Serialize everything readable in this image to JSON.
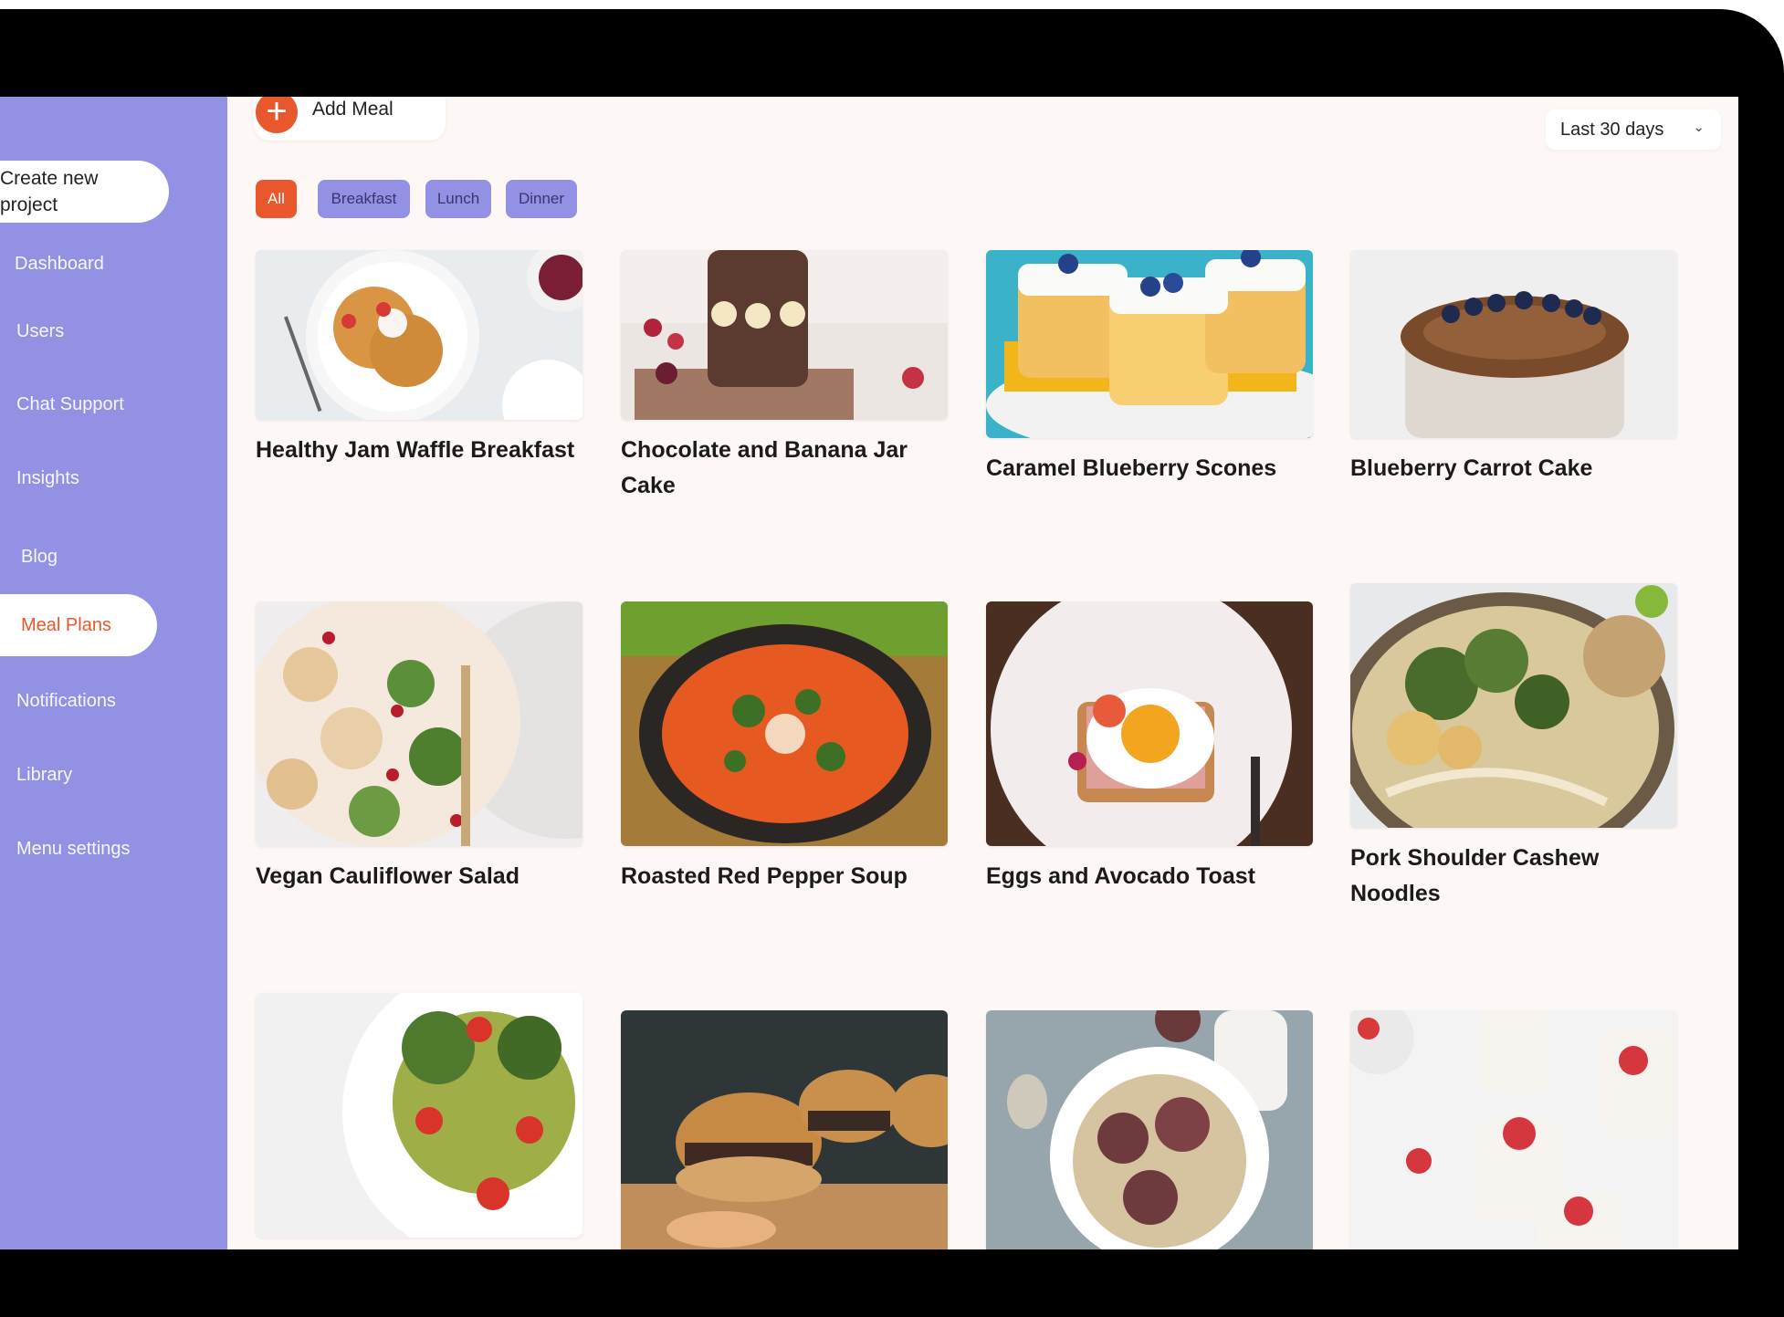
{
  "sidebar": {
    "create_project": "Create new project",
    "items": [
      {
        "label": "Dashboard"
      },
      {
        "label": "Users"
      },
      {
        "label": "Chat Support"
      },
      {
        "label": "Insights"
      },
      {
        "label": "Blog"
      },
      {
        "label": "Meal Plans",
        "active": true
      },
      {
        "label": "Notifications"
      },
      {
        "label": "Library"
      },
      {
        "label": "Menu settings"
      }
    ]
  },
  "toolbar": {
    "add_meal": "Add Meal",
    "range": "Last 30 days"
  },
  "filters": [
    {
      "label": "All",
      "active": true
    },
    {
      "label": "Breakfast"
    },
    {
      "label": "Lunch"
    },
    {
      "label": "Dinner"
    }
  ],
  "meals": [
    {
      "title": "Healthy Jam Waffle Breakfast"
    },
    {
      "title": "Chocolate and Banana Jar Cake"
    },
    {
      "title": "Caramel Blueberry Scones"
    },
    {
      "title": "Blueberry Carrot Cake"
    },
    {
      "title": "Vegan Cauliflower Salad"
    },
    {
      "title": "Roasted Red Pepper Soup"
    },
    {
      "title": "Eggs and Avocado Toast"
    },
    {
      "title": "Pork Shoulder Cashew Noodles"
    },
    {
      "title": ""
    },
    {
      "title": ""
    },
    {
      "title": ""
    },
    {
      "title": ""
    }
  ],
  "colors": {
    "sidebar": "#9391e3",
    "accent": "#e8582c",
    "background": "#fdf8f6"
  }
}
